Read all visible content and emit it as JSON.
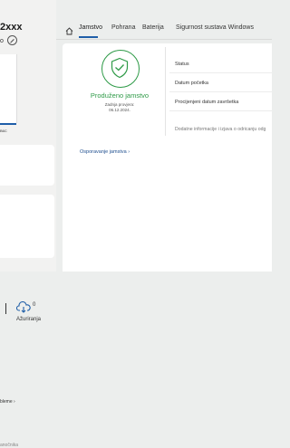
{
  "device": {
    "title_fragment": "2xxx",
    "subtitle_fragment": "o",
    "model_fragment": "B6C",
    "updates_count": "0",
    "updates_label": "Ažuriranja",
    "problems_link": "bleme ›",
    "manual_fragment": "anočnika"
  },
  "tabs": [
    {
      "label": "Jamstvo",
      "active": true
    },
    {
      "label": "Pohrana",
      "active": false
    },
    {
      "label": "Baterija",
      "active": false
    },
    {
      "label": "Sigurnost sustava Windows",
      "active": false
    }
  ],
  "warranty": {
    "status_title": "Produženo jamstvo",
    "expires_label": "Zadnja provjera:",
    "expires_date": "06.12.2024."
  },
  "details": {
    "rows": [
      {
        "label": "Status"
      },
      {
        "label": "Datum početka"
      },
      {
        "label": "Procijenjeni datum završetka"
      }
    ],
    "info_text": "Dodatne informacije i izjava o odricanju odg"
  },
  "restore_link": "Osporavanje jamstva ›",
  "colors": {
    "accent": "#1f5ea8",
    "warranty_green": "#2e9a47",
    "background": "#eceeed",
    "panel": "#ffffff"
  },
  "icons": [
    "edit-icon",
    "home-icon",
    "cloud-download-icon",
    "shield-check-icon"
  ]
}
